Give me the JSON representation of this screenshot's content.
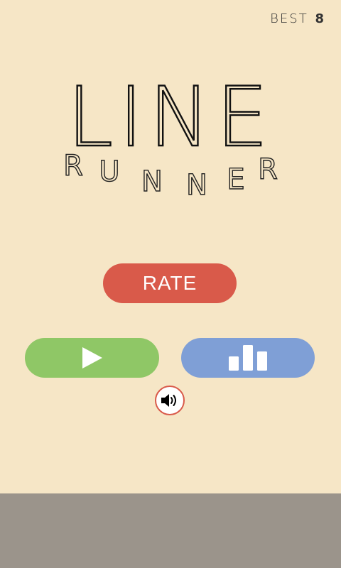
{
  "best": {
    "label": "BEST",
    "value": "8"
  },
  "logo": {
    "title": "LINE",
    "subtitle_letters": [
      "R",
      "U",
      "N",
      "N",
      "E",
      "R"
    ]
  },
  "buttons": {
    "rate": "RATE",
    "play_icon": "play-icon",
    "leaderboard_icon": "leaderboard-icon",
    "sound_icon": "speaker-icon"
  },
  "colors": {
    "background": "#f6e6c6",
    "rate": "#d95a4a",
    "play": "#8fc766",
    "leaderboard": "#7f9fd6",
    "ground": "#9b948b"
  }
}
